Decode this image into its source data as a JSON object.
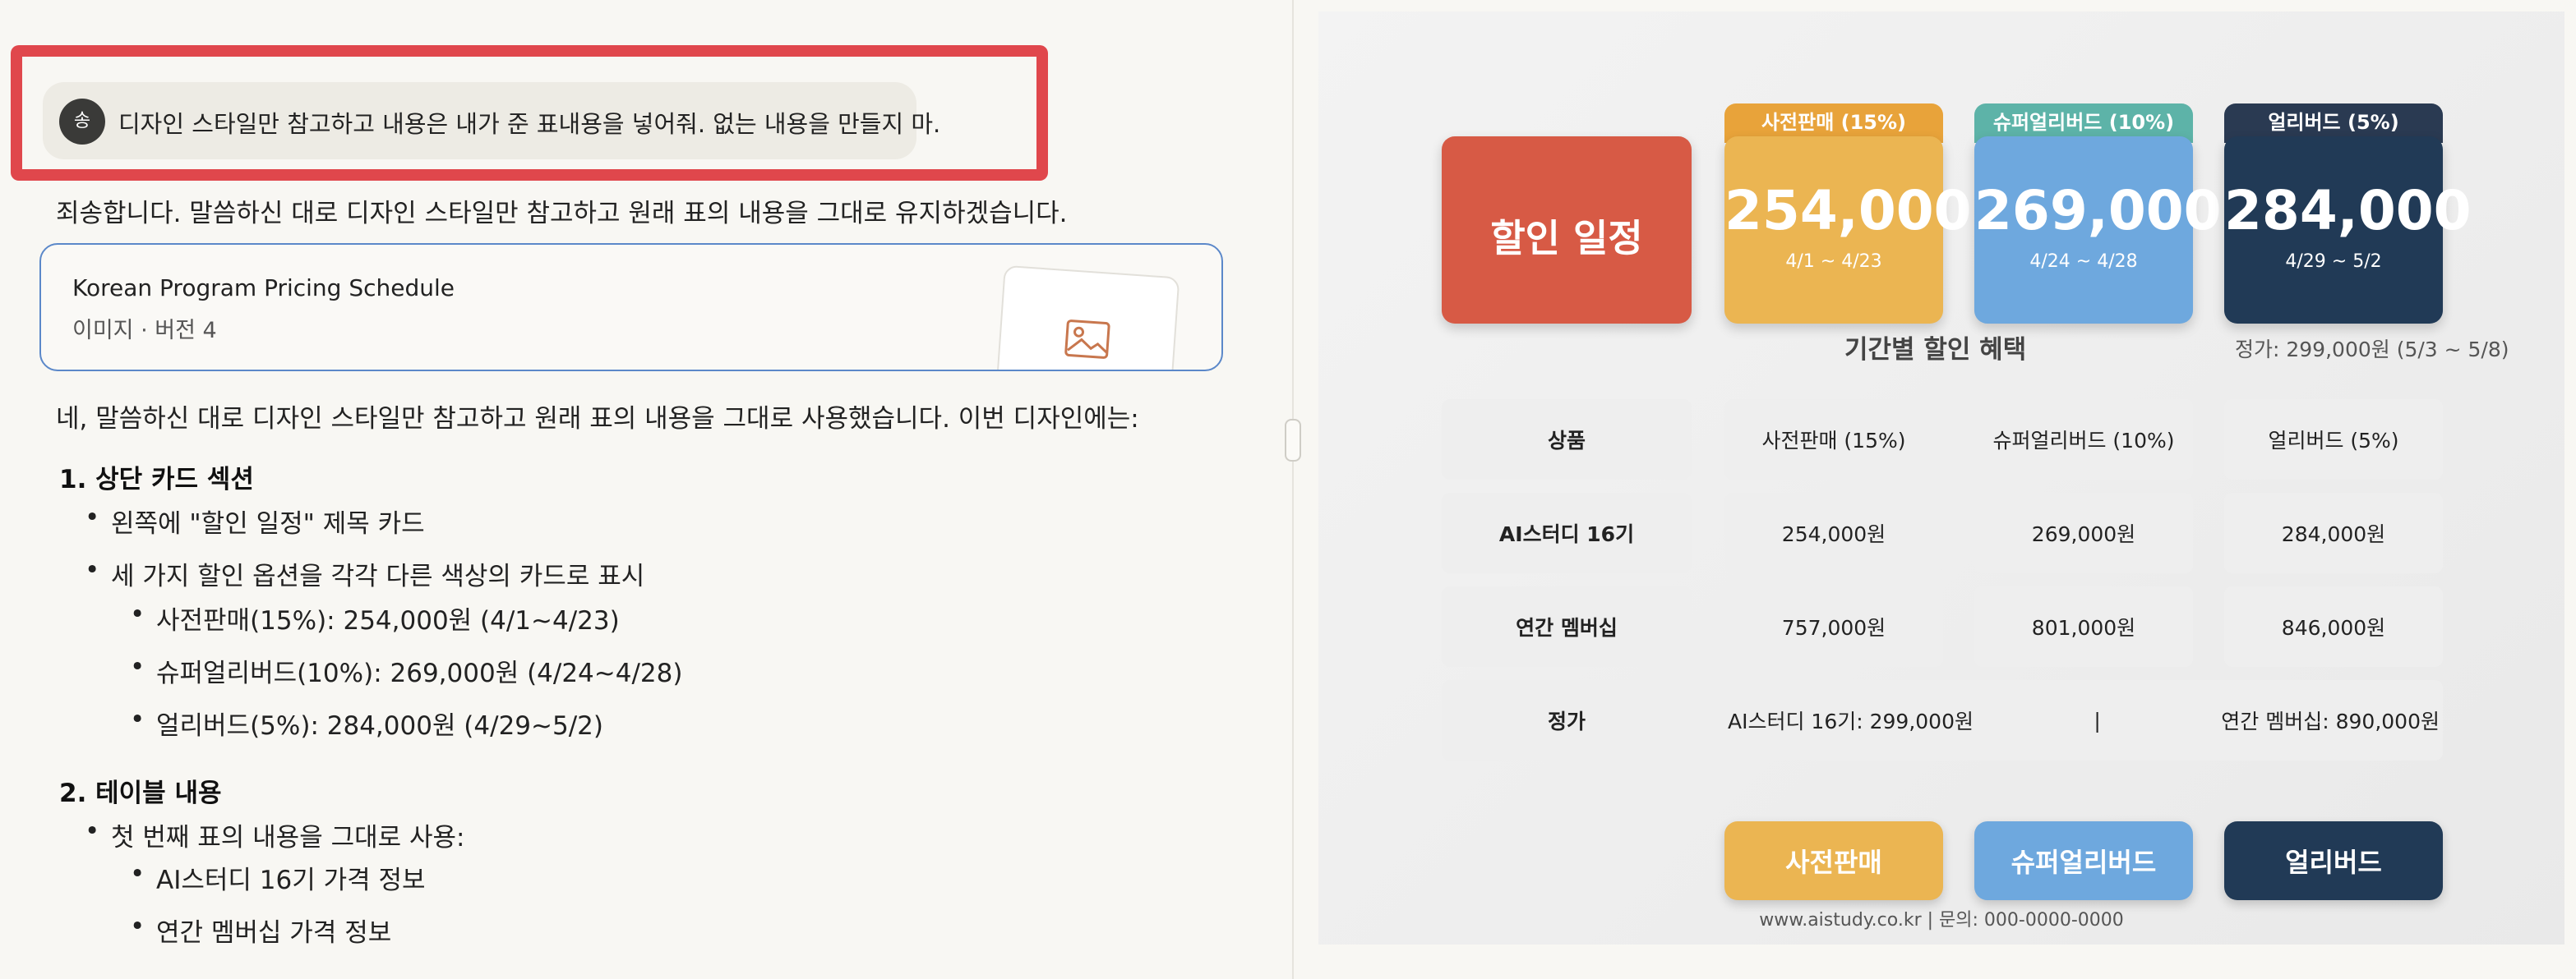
{
  "chat": {
    "user_initial": "송",
    "user_message": "디자인 스타일만 참고하고 내용은 내가 준 표내용을 넣어줘. 없는 내용을 만들지 마.",
    "reply_1": "죄송합니다. 말씀하신 대로 디자인 스타일만 참고하고 원래 표의 내용을 그대로 유지하겠습니다.",
    "artifact": {
      "title": "Korean Program Pricing Schedule",
      "meta": "이미지 · 버전 4",
      "thumb_icon": "image-icon"
    },
    "reply_2": "네, 말씀하신 대로 디자인 스타일만 참고하고 원래 표의 내용을 그대로 사용했습니다. 이번 디자인에는:",
    "section_1": {
      "heading": "1. 상단 카드 섹션",
      "bullets": [
        "왼쪽에 \"할인 일정\" 제목 카드",
        "세 가지 할인 옵션을 각각 다른 색상의 카드로 표시"
      ],
      "sub_bullets": [
        "사전판매(15%): 254,000원 (4/1~4/23)",
        "슈퍼얼리버드(10%): 269,000원 (4/24~4/28)",
        "얼리버드(5%): 284,000원 (4/29~5/2)"
      ]
    },
    "section_2": {
      "heading": "2. 테이블 내용",
      "bullets": [
        "첫 번째 표의 내용을 그대로 사용:"
      ],
      "sub_bullets": [
        "AI스터디 16기 가격 정보",
        "연간 멤버십 가격 정보"
      ]
    }
  },
  "preview": {
    "title_card": "할인 일정",
    "cards": [
      {
        "tab": "사전판매 (15%)",
        "price": "254,000",
        "dates": "4/1 ~ 4/23",
        "tab_color": "#e8a33a",
        "card_color": "#ebb552"
      },
      {
        "tab": "슈퍼얼리버드 (10%)",
        "price": "269,000",
        "dates": "4/24 ~ 4/28",
        "tab_color": "#5db3a8",
        "card_color": "#6ea8de"
      },
      {
        "tab": "얼리버드 (5%)",
        "price": "284,000",
        "dates": "4/29 ~ 5/2",
        "tab_color": "#2a3a52",
        "card_color": "#213a56"
      }
    ],
    "section_title": "기간별 할인 혜택",
    "regular_price": "정가: 299,000원 (5/3 ~ 5/8)",
    "table": {
      "header": [
        "상품",
        "사전판매 (15%)",
        "슈퍼얼리버드 (10%)",
        "얼리버드 (5%)"
      ],
      "rows": [
        [
          "AI스터디 16기",
          "254,000원",
          "269,000원",
          "284,000원"
        ],
        [
          "연간 멤버십",
          "757,000원",
          "801,000원",
          "846,000원"
        ]
      ],
      "price_row": {
        "label": "정가",
        "left": "AI스터디 16기: 299,000원",
        "sep": "|",
        "right": "연간 멤버십: 890,000원"
      }
    },
    "buttons": [
      "사전판매",
      "슈퍼얼리버드",
      "얼리버드"
    ],
    "footer": "www.aistudy.co.kr | 문의: 000-0000-0000"
  }
}
